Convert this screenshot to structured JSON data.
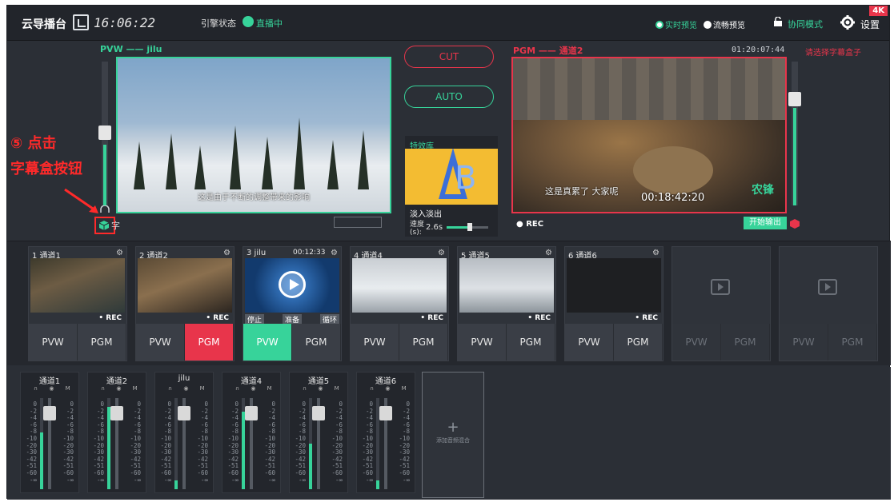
{
  "header": {
    "app_title": "云导播台",
    "clock": "16:06:22",
    "engine_label": "引擎状态",
    "engine_status": "直播中",
    "preview_realtime": "实时预览",
    "preview_smooth": "流畅预览",
    "collab_mode": "协同模式",
    "settings": "设置",
    "badge": "4K"
  },
  "pvw": {
    "label": "PVW —— jilu",
    "subtitle": "这是由于不断的调整带来的影响"
  },
  "pgm": {
    "label": "PGM —— 通道2",
    "timer": "01:20:07:44",
    "caption_select": "请选择字幕盒子",
    "subtitle": "这是真累了 大家呢",
    "overlay_time": "00:18:42:20",
    "logo": "农锋",
    "rec": "● REC",
    "start_output": "开始输出"
  },
  "controls": {
    "cut": "CUT",
    "auto": "AUTO"
  },
  "effects": {
    "title": "特效库",
    "name": "淡入淡出",
    "speed_label": "速度(s):",
    "speed_value": "2.6s",
    "speed_fraction": 0.55
  },
  "annotation": {
    "line1": "⑤ 点击",
    "line2": "字幕盒按钮"
  },
  "caption_box_label": "字",
  "sources": [
    {
      "name": "1 通道1",
      "rec": "• REC",
      "pvw": "PVW",
      "pgm": "PGM",
      "state": "none",
      "thumb": "people"
    },
    {
      "name": "2 通道2",
      "rec": "• REC",
      "pvw": "PVW",
      "pgm": "PGM",
      "state": "pgm",
      "thumb": "farm"
    },
    {
      "name": "3 jilu",
      "time": "00:12:33",
      "pvw": "PVW",
      "pgm": "PGM",
      "state": "pvw",
      "thumb": "player",
      "stop": "停止",
      "ready": "准备",
      "loop": "循环"
    },
    {
      "name": "4 通道4",
      "rec": "• REC",
      "pvw": "PVW",
      "pgm": "PGM",
      "state": "none",
      "thumb": "room"
    },
    {
      "name": "5 通道5",
      "rec": "• REC",
      "pvw": "PVW",
      "pgm": "PGM",
      "state": "none",
      "thumb": "room2"
    },
    {
      "name": "6 通道6",
      "rec": "• REC",
      "pvw": "PVW",
      "pgm": "PGM",
      "state": "none",
      "thumb": "dark"
    },
    {
      "name": "",
      "pvw": "PVW",
      "pgm": "PGM",
      "state": "empty",
      "thumb": "empty"
    },
    {
      "name": "",
      "pvw": "PVW",
      "pgm": "PGM",
      "state": "empty",
      "thumb": "empty"
    }
  ],
  "mixer": {
    "icons": "∩ ◉ M",
    "scale": [
      "0",
      "-2",
      "-4",
      "-6",
      "-8",
      "-10",
      "-20",
      "-30",
      "-42",
      "-51",
      "-60",
      "-∞"
    ],
    "channels": [
      {
        "name": "通道1",
        "level": 0.62,
        "fader": 0.9
      },
      {
        "name": "通道2",
        "level": 0.9,
        "fader": 0.9
      },
      {
        "name": "jilu",
        "level": 0.1,
        "fader": 0.9
      },
      {
        "name": "通道4",
        "level": 0.85,
        "fader": 0.9
      },
      {
        "name": "通道5",
        "level": 0.5,
        "fader": 0.9
      },
      {
        "name": "通道6",
        "level": 0.1,
        "fader": 0.9
      }
    ],
    "add_label": "添加音频混合"
  },
  "colors": {
    "accent_green": "#37d39a",
    "accent_red": "#e8354b"
  }
}
